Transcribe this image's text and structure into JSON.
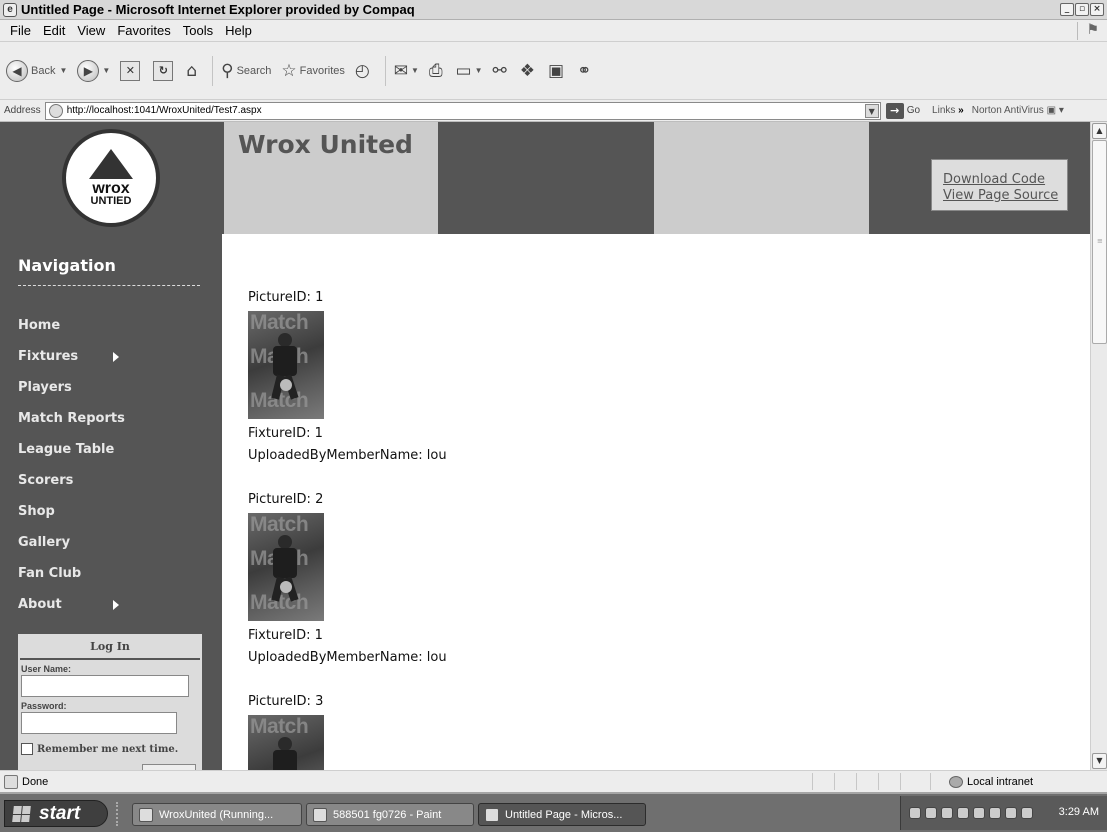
{
  "window": {
    "title": "Untitled Page - Microsoft Internet Explorer provided by Compaq",
    "buttons": [
      "minimize",
      "maximize",
      "close"
    ]
  },
  "menu": [
    "File",
    "Edit",
    "View",
    "Favorites",
    "Tools",
    "Help"
  ],
  "toolbar": {
    "back": "Back",
    "search": "Search",
    "favorites": "Favorites"
  },
  "address": {
    "label": "Address",
    "url": "http://localhost:1041/WroxUnited/Test7.aspx",
    "go": "Go",
    "links": "Links",
    "links_chevron": "»",
    "extension": "Norton AntiVirus"
  },
  "site": {
    "logo_line1": "wrox",
    "logo_line2": "UNTIED",
    "title": "Wrox United",
    "links": [
      "Download Code",
      "View Page Source"
    ]
  },
  "nav": {
    "heading": "Navigation",
    "items": [
      {
        "label": "Home",
        "has_submenu": false
      },
      {
        "label": "Fixtures",
        "has_submenu": true
      },
      {
        "label": "Players",
        "has_submenu": false
      },
      {
        "label": "Match Reports",
        "has_submenu": false
      },
      {
        "label": "League Table",
        "has_submenu": false
      },
      {
        "label": "Scorers",
        "has_submenu": false
      },
      {
        "label": "Shop",
        "has_submenu": false
      },
      {
        "label": "Gallery",
        "has_submenu": false
      },
      {
        "label": "Fan Club",
        "has_submenu": false
      },
      {
        "label": "About",
        "has_submenu": true
      }
    ]
  },
  "login": {
    "title": "Log In",
    "username_label": "User Name:",
    "username_value": "",
    "password_label": "Password:",
    "password_value": "",
    "remember_label": "Remember me next time."
  },
  "records": [
    {
      "picture": "PictureID: 1",
      "fixture": "FixtureID: 1",
      "uploader": "UploadedByMemberName: lou"
    },
    {
      "picture": "PictureID: 2",
      "fixture": "FixtureID: 1",
      "uploader": "UploadedByMemberName: lou"
    },
    {
      "picture": "PictureID: 3",
      "fixture": "",
      "uploader": ""
    }
  ],
  "thumb_watermark": "Match",
  "status": {
    "text": "Done",
    "zone": "Local intranet"
  },
  "taskbar": {
    "start": "start",
    "tasks": [
      {
        "label": "WroxUnited (Running...",
        "active": false
      },
      {
        "label": "588501 fg0726 - Paint",
        "active": false
      },
      {
        "label": "Untitled Page - Micros...",
        "active": true
      }
    ],
    "clock": "3:29 AM"
  }
}
